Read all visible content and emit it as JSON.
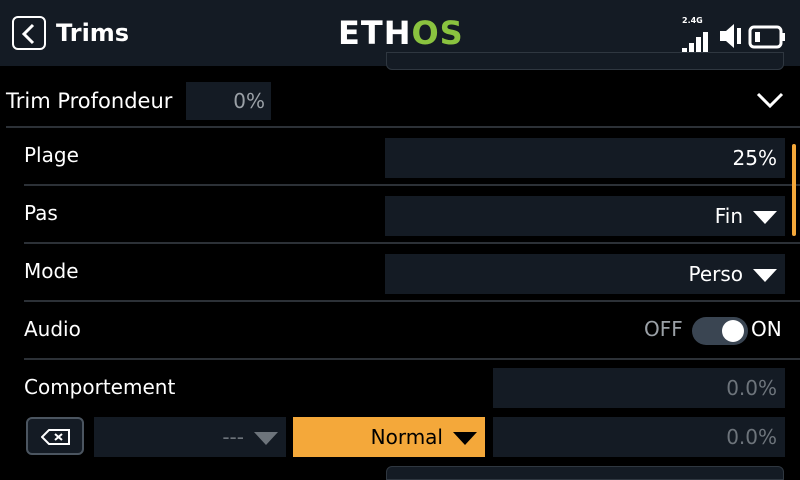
{
  "header": {
    "title": "Trims",
    "logo_left": "ETH",
    "logo_right": "OS",
    "signal_label": "2.4G"
  },
  "section": {
    "label": "Trim Profondeur",
    "value": "0%"
  },
  "rows": {
    "plage": {
      "label": "Plage",
      "value": "25%"
    },
    "pas": {
      "label": "Pas",
      "value": "Fin"
    },
    "mode": {
      "label": "Mode",
      "value": "Perso"
    },
    "audio": {
      "label": "Audio",
      "off_label": "OFF",
      "on_label": "ON",
      "state": "on"
    },
    "comportement": {
      "label": "Comportement",
      "offset_value": "0.0%",
      "source_value": "---",
      "behavior_value": "Normal",
      "behavior_offset_value": "0.0%"
    }
  },
  "colors": {
    "accent": "#f4a83a",
    "logo_green": "#8ac33f",
    "panel": "#141b24",
    "header_bg": "#141b24"
  },
  "icons": {
    "back": "chevron-left-icon",
    "signal": "signal-bars-icon",
    "speaker": "speaker-icon",
    "battery": "battery-icon",
    "collapse": "chevron-down-icon",
    "clear": "backspace-icon"
  }
}
